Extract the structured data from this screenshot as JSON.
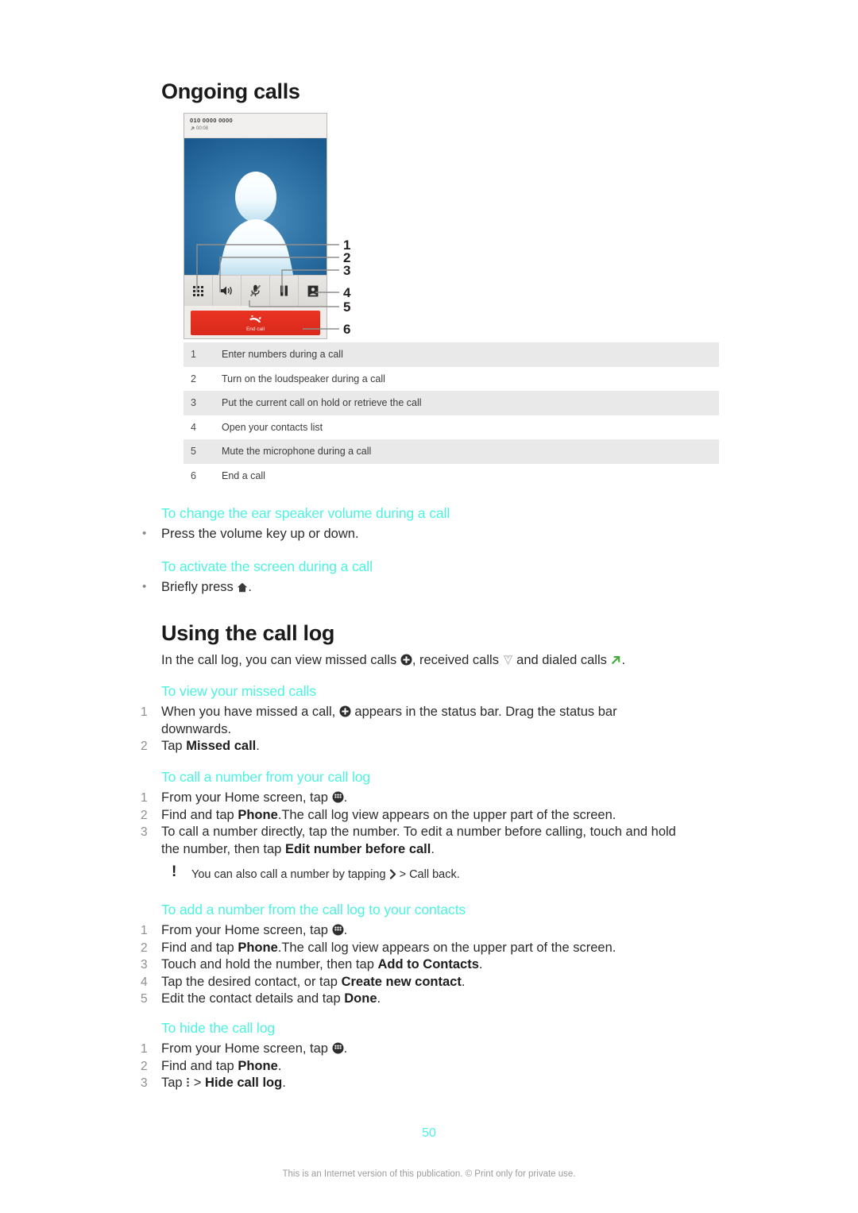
{
  "document": {
    "page_number": "50",
    "footnote": "This is an Internet version of this publication. © Print only for private use."
  },
  "section_ongoing": {
    "title": "Ongoing calls",
    "figure": {
      "phone_number": "010 0000 0000",
      "call_timer": "00:08",
      "end_call_label": "End call",
      "toolbar_icons": [
        "keypad-icon",
        "loudspeaker-icon",
        "mute-microphone-icon",
        "pause-call-icon",
        "contacts-book-icon"
      ],
      "callout_numbers": [
        "1",
        "2",
        "3",
        "4",
        "5",
        "6"
      ]
    },
    "legend": [
      {
        "num": "1",
        "text": "Enter numbers during a call"
      },
      {
        "num": "2",
        "text": "Turn on the loudspeaker during a call"
      },
      {
        "num": "3",
        "text": "Put the current call on hold or retrieve the call"
      },
      {
        "num": "4",
        "text": "Open your contacts list"
      },
      {
        "num": "5",
        "text": "Mute the microphone during a call"
      },
      {
        "num": "6",
        "text": "End a call"
      }
    ],
    "task_volume": {
      "heading": "To change the ear speaker volume during a call",
      "bullet": "Press the volume key up or down."
    },
    "task_activate": {
      "heading": "To activate the screen during a call",
      "bullet_pre": "Briefly press",
      "bullet_post": "."
    }
  },
  "section_call_log": {
    "title": "Using the call log",
    "intro_a": "In the call log, you can view missed calls",
    "intro_b": ", received calls",
    "intro_c": "and dialed calls",
    "intro_d": ".",
    "task_missed": {
      "heading": "To view your missed calls",
      "step1_a": "When you have missed a call,",
      "step1_b": "appears in the status bar. Drag the status bar downwards.",
      "step2_a": "Tap",
      "step2_bold": "Missed call",
      "step2_b": "."
    },
    "task_call_number": {
      "heading": "To call a number from your call log",
      "step1_a": "From your Home screen, tap",
      "step1_b": ".",
      "step2_a": "Find and tap",
      "step2_bold": "Phone",
      "step2_b": ".The call log view appears on the upper part of the screen.",
      "step3_a": "To call a number directly, tap the number. To edit a number before calling, touch and hold the number, then tap",
      "step3_bold": "Edit number before call",
      "step3_b": ".",
      "tip_a": "You can also call a number by tapping",
      "tip_b": "> Call back."
    },
    "task_add_contact": {
      "heading": "To add a number from the call log to your contacts",
      "step1_a": "From your Home screen, tap",
      "step1_b": ".",
      "step2_a": "Find and tap",
      "step2_bold": "Phone",
      "step2_b": ".The call log view appears on the upper part of the screen.",
      "step3_a": "Touch and hold the number, then tap",
      "step3_bold": "Add to Contacts",
      "step3_b": ".",
      "step4_a": "Tap the desired contact, or tap",
      "step4_bold": "Create new contact",
      "step4_b": ".",
      "step5_a": "Edit the contact details and tap",
      "step5_bold": "Done",
      "step5_b": "."
    },
    "task_hide_log": {
      "heading": "To hide the call log",
      "step1_a": "From your Home screen, tap",
      "step1_b": ".",
      "step2_a": "Find and tap",
      "step2_bold": "Phone",
      "step2_b": ".",
      "step3_a": "Tap",
      "step3_mid": ">",
      "step3_bold": "Hide call log",
      "step3_b": "."
    }
  },
  "colors": {
    "heading_accent": "#4df3e0",
    "end_call_red": "#e03120",
    "dialed_green": "#3faa35",
    "phone_blue": "#2f73a6"
  },
  "markers": {
    "bullet": "•",
    "n1": "1",
    "n2": "2",
    "n3": "3",
    "n4": "4",
    "n5": "5",
    "bang": "!"
  }
}
